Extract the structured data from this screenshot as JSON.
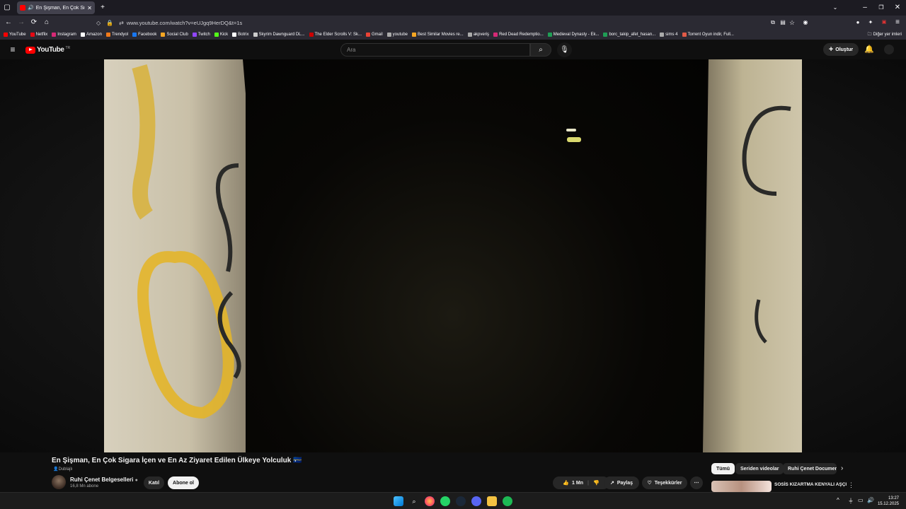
{
  "browser": {
    "tab_title": "En Şişman, En Çok Sigara İçen ve En Az Ziyaret Edilen Ülkeye Yolculuk",
    "url": "www.youtube.com/watch?v=eUJgq9HerDQ&t=1s",
    "bookmarks": [
      {
        "label": "YouTube",
        "color": "#ff0000"
      },
      {
        "label": "Netflix",
        "color": "#e50914"
      },
      {
        "label": "Instagram",
        "color": "#d62976"
      },
      {
        "label": "Amazon",
        "color": "#ffffff"
      },
      {
        "label": "Trendyol",
        "color": "#f27a1a"
      },
      {
        "label": "Facebook",
        "color": "#1877f2"
      },
      {
        "label": "Social Club",
        "color": "#f5a623"
      },
      {
        "label": "Twitch",
        "color": "#9146ff"
      },
      {
        "label": "Kick",
        "color": "#53fc18"
      },
      {
        "label": "Botrix",
        "color": "#ffffff"
      },
      {
        "label": "Skyrim Dawnguard DL...",
        "color": "#cccccc"
      },
      {
        "label": "The Elder Scrolls V: Sk...",
        "color": "#cc0000"
      },
      {
        "label": "Gmail",
        "color": "#ea4335"
      },
      {
        "label": "youtube",
        "color": "#aaaaaa"
      },
      {
        "label": "Best Similar Movies re...",
        "color": "#f5a623"
      },
      {
        "label": "akpveriş",
        "color": "#aaaaaa"
      },
      {
        "label": "Red Dead Redemptio...",
        "color": "#d62976"
      },
      {
        "label": "Medieval Dynasty - Ek...",
        "color": "#1f9d55"
      },
      {
        "label": "borc_takip_afet_hasan...",
        "color": "#1f9d55"
      },
      {
        "label": "sims 4",
        "color": "#aaaaaa"
      },
      {
        "label": "Torrent Oyun indir, Full...",
        "color": "#e05a47"
      }
    ],
    "other_bookmarks": "Diğer yer imleri"
  },
  "youtube": {
    "logo_text": "YouTube",
    "country_code": "TR",
    "search_placeholder": "Ara",
    "create_label": "Oluştur"
  },
  "video": {
    "title": "En Şişman, En Çok Sigara İçen ve En Az Ziyaret Edilen Ülkeye Yolculuk",
    "flag": "🇳🇷",
    "dubbed_label": "Dublajlı",
    "channel": "Ruhi Çenet Belgeselleri",
    "subscribers": "16,8 Mn abone",
    "join_label": "Katıl",
    "subscribe_label": "Abone ol",
    "likes": "1 Mn",
    "share_label": "Paylaş",
    "thanks_label": "Teşekkürler"
  },
  "recommendations": {
    "chips": [
      "Tümü",
      "Seriden videolar",
      "Ruhi Çenet Documen"
    ],
    "first_title": "SOSİS KIZARTMA KENYALI AŞÇI"
  },
  "taskbar": {
    "time": "13:27",
    "date": "15.12.2025"
  }
}
